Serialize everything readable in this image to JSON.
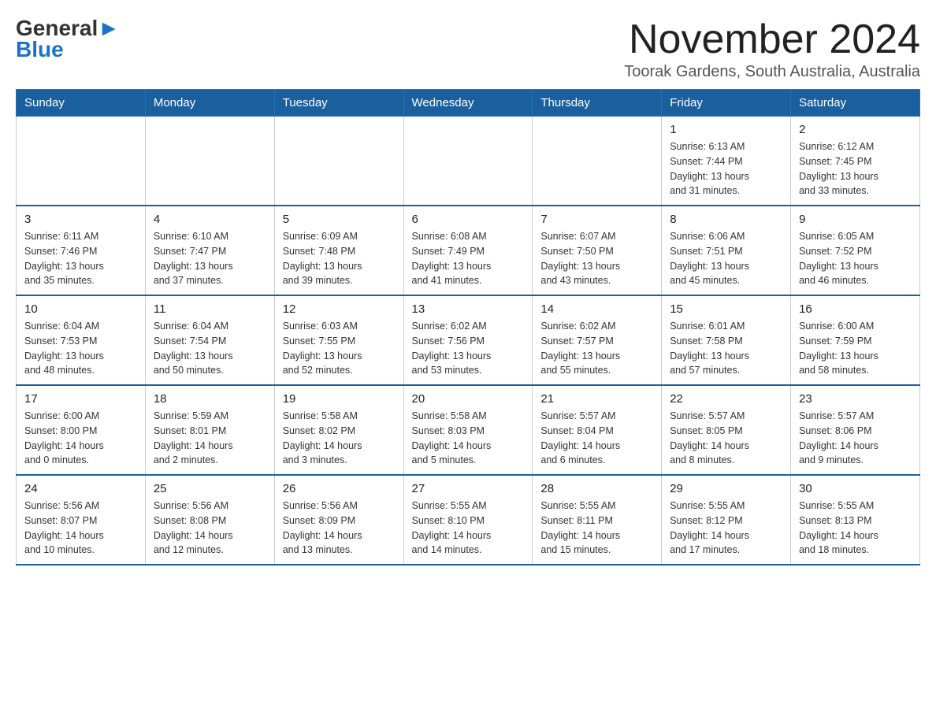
{
  "header": {
    "logo_general": "General",
    "logo_blue": "Blue",
    "month": "November 2024",
    "location": "Toorak Gardens, South Australia, Australia"
  },
  "days_of_week": [
    "Sunday",
    "Monday",
    "Tuesday",
    "Wednesday",
    "Thursday",
    "Friday",
    "Saturday"
  ],
  "weeks": [
    [
      {
        "day": "",
        "info": ""
      },
      {
        "day": "",
        "info": ""
      },
      {
        "day": "",
        "info": ""
      },
      {
        "day": "",
        "info": ""
      },
      {
        "day": "",
        "info": ""
      },
      {
        "day": "1",
        "info": "Sunrise: 6:13 AM\nSunset: 7:44 PM\nDaylight: 13 hours\nand 31 minutes."
      },
      {
        "day": "2",
        "info": "Sunrise: 6:12 AM\nSunset: 7:45 PM\nDaylight: 13 hours\nand 33 minutes."
      }
    ],
    [
      {
        "day": "3",
        "info": "Sunrise: 6:11 AM\nSunset: 7:46 PM\nDaylight: 13 hours\nand 35 minutes."
      },
      {
        "day": "4",
        "info": "Sunrise: 6:10 AM\nSunset: 7:47 PM\nDaylight: 13 hours\nand 37 minutes."
      },
      {
        "day": "5",
        "info": "Sunrise: 6:09 AM\nSunset: 7:48 PM\nDaylight: 13 hours\nand 39 minutes."
      },
      {
        "day": "6",
        "info": "Sunrise: 6:08 AM\nSunset: 7:49 PM\nDaylight: 13 hours\nand 41 minutes."
      },
      {
        "day": "7",
        "info": "Sunrise: 6:07 AM\nSunset: 7:50 PM\nDaylight: 13 hours\nand 43 minutes."
      },
      {
        "day": "8",
        "info": "Sunrise: 6:06 AM\nSunset: 7:51 PM\nDaylight: 13 hours\nand 45 minutes."
      },
      {
        "day": "9",
        "info": "Sunrise: 6:05 AM\nSunset: 7:52 PM\nDaylight: 13 hours\nand 46 minutes."
      }
    ],
    [
      {
        "day": "10",
        "info": "Sunrise: 6:04 AM\nSunset: 7:53 PM\nDaylight: 13 hours\nand 48 minutes."
      },
      {
        "day": "11",
        "info": "Sunrise: 6:04 AM\nSunset: 7:54 PM\nDaylight: 13 hours\nand 50 minutes."
      },
      {
        "day": "12",
        "info": "Sunrise: 6:03 AM\nSunset: 7:55 PM\nDaylight: 13 hours\nand 52 minutes."
      },
      {
        "day": "13",
        "info": "Sunrise: 6:02 AM\nSunset: 7:56 PM\nDaylight: 13 hours\nand 53 minutes."
      },
      {
        "day": "14",
        "info": "Sunrise: 6:02 AM\nSunset: 7:57 PM\nDaylight: 13 hours\nand 55 minutes."
      },
      {
        "day": "15",
        "info": "Sunrise: 6:01 AM\nSunset: 7:58 PM\nDaylight: 13 hours\nand 57 minutes."
      },
      {
        "day": "16",
        "info": "Sunrise: 6:00 AM\nSunset: 7:59 PM\nDaylight: 13 hours\nand 58 minutes."
      }
    ],
    [
      {
        "day": "17",
        "info": "Sunrise: 6:00 AM\nSunset: 8:00 PM\nDaylight: 14 hours\nand 0 minutes."
      },
      {
        "day": "18",
        "info": "Sunrise: 5:59 AM\nSunset: 8:01 PM\nDaylight: 14 hours\nand 2 minutes."
      },
      {
        "day": "19",
        "info": "Sunrise: 5:58 AM\nSunset: 8:02 PM\nDaylight: 14 hours\nand 3 minutes."
      },
      {
        "day": "20",
        "info": "Sunrise: 5:58 AM\nSunset: 8:03 PM\nDaylight: 14 hours\nand 5 minutes."
      },
      {
        "day": "21",
        "info": "Sunrise: 5:57 AM\nSunset: 8:04 PM\nDaylight: 14 hours\nand 6 minutes."
      },
      {
        "day": "22",
        "info": "Sunrise: 5:57 AM\nSunset: 8:05 PM\nDaylight: 14 hours\nand 8 minutes."
      },
      {
        "day": "23",
        "info": "Sunrise: 5:57 AM\nSunset: 8:06 PM\nDaylight: 14 hours\nand 9 minutes."
      }
    ],
    [
      {
        "day": "24",
        "info": "Sunrise: 5:56 AM\nSunset: 8:07 PM\nDaylight: 14 hours\nand 10 minutes."
      },
      {
        "day": "25",
        "info": "Sunrise: 5:56 AM\nSunset: 8:08 PM\nDaylight: 14 hours\nand 12 minutes."
      },
      {
        "day": "26",
        "info": "Sunrise: 5:56 AM\nSunset: 8:09 PM\nDaylight: 14 hours\nand 13 minutes."
      },
      {
        "day": "27",
        "info": "Sunrise: 5:55 AM\nSunset: 8:10 PM\nDaylight: 14 hours\nand 14 minutes."
      },
      {
        "day": "28",
        "info": "Sunrise: 5:55 AM\nSunset: 8:11 PM\nDaylight: 14 hours\nand 15 minutes."
      },
      {
        "day": "29",
        "info": "Sunrise: 5:55 AM\nSunset: 8:12 PM\nDaylight: 14 hours\nand 17 minutes."
      },
      {
        "day": "30",
        "info": "Sunrise: 5:55 AM\nSunset: 8:13 PM\nDaylight: 14 hours\nand 18 minutes."
      }
    ]
  ]
}
